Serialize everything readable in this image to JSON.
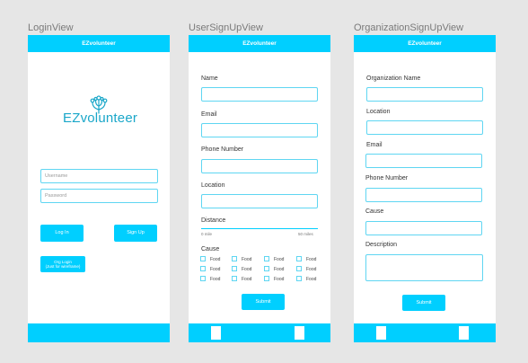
{
  "views": {
    "login": {
      "title": "LoginView",
      "app_title": "EZvolunteer",
      "logo_text": "EZvolunteer",
      "username_placeholder": "Username",
      "password_placeholder": "Password",
      "login_label": "Log In",
      "signup_label": "Sign Up",
      "org_login_label": "Org Login\n(Just for wireframe)"
    },
    "user_signup": {
      "title": "UserSignUpView",
      "app_title": "EZvolunteer",
      "name_label": "Name",
      "email_label": "Email",
      "phone_label": "Phone Number",
      "location_label": "Location",
      "distance_label": "Distance",
      "distance_min": "0 mile",
      "distance_max": "50 miles",
      "cause_label": "Cause",
      "cause_options": [
        [
          "Food",
          "Food",
          "Food",
          "Food"
        ],
        [
          "Food",
          "Food",
          "Food",
          "Food"
        ],
        [
          "Food",
          "Food",
          "Food",
          "Food"
        ]
      ],
      "submit_label": "Submit"
    },
    "org_signup": {
      "title": "OrganizationSignUpView",
      "app_title": "EZvolunteer",
      "org_name_label": "Organization Name",
      "location_label": "Location",
      "email_label": "Email",
      "phone_label": "Phone Number",
      "cause_label": "Cause",
      "description_label": "Description",
      "submit_label": "Submit"
    }
  },
  "colors": {
    "accent": "#00cfff",
    "field_border": "#5fd6f2",
    "logo": "#1aa7c9",
    "background": "#e6e6e6"
  },
  "icons": {
    "logo": "people-tree-icon"
  }
}
